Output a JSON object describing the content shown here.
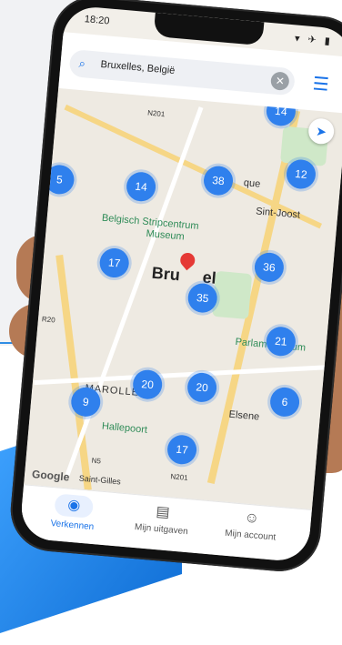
{
  "status": {
    "time": "18:20",
    "icons": "▾ ✈ ▮"
  },
  "search": {
    "query": "Bruxelles, België",
    "clear_icon": "✕",
    "search_icon": "⌕"
  },
  "filter_icon": "☰",
  "compass_icon": "➤",
  "map": {
    "labels": [
      "N201",
      "Sint-Joost",
      "Belgisch Stripcentrum",
      "Museum",
      "Bru",
      "el",
      "Parlamentarium",
      "MAROLLEN",
      "Hallepoort",
      "Elsene",
      "N5",
      "N201",
      "Saint-Gilles",
      "que",
      "R20"
    ],
    "clusters": [
      "14",
      "12",
      "38",
      "14",
      "5",
      "17",
      "36",
      "35",
      "21",
      "20",
      "20",
      "9",
      "6",
      "17"
    ],
    "google": "Google"
  },
  "nav": {
    "items": [
      {
        "label": "Verkennen",
        "icon": "◉"
      },
      {
        "label": "Mijn uitgaven",
        "icon": "▤"
      },
      {
        "label": "Mijn account",
        "icon": "☺"
      }
    ]
  }
}
